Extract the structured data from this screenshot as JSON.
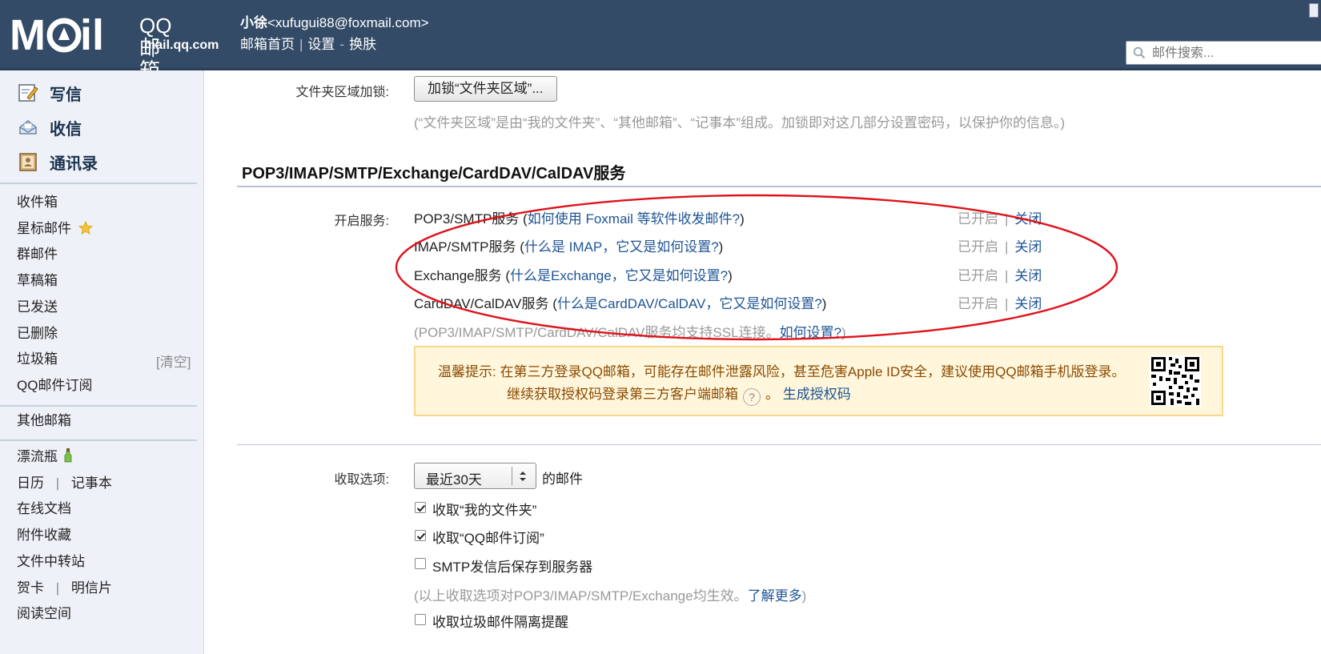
{
  "header": {
    "logo_mail": "M⊙il",
    "logo_qq": "QQ邮箱",
    "logo_domain": "mail.qq.com",
    "user_name": "小徐",
    "user_email": "<xufugui88@foxmail.com>",
    "nav": [
      "邮箱首页",
      "|",
      "设置",
      "-",
      "换肤"
    ],
    "search_placeholder": "邮件搜索..."
  },
  "sidebar": {
    "actions": [
      {
        "label": "写信",
        "icon": "compose-icon"
      },
      {
        "label": "收信",
        "icon": "inbox-tray-icon"
      },
      {
        "label": "通讯录",
        "icon": "contacts-icon"
      }
    ],
    "folders": [
      "收件箱",
      "星标邮件",
      "群邮件",
      "草稿箱",
      "已发送",
      "已删除",
      "垃圾箱",
      "QQ邮件订阅"
    ],
    "spam_clear": "[清空]",
    "other_mail": "其他邮箱",
    "tools": {
      "drift_bottle": "漂流瓶",
      "calendar": "日历",
      "sep": "|",
      "notepad": "记事本",
      "online_docs": "在线文档",
      "attachments": "附件收藏",
      "file_transfer": "文件中转站",
      "greeting_card": "贺卡",
      "postcard": "明信片",
      "reading": "阅读空间"
    }
  },
  "main": {
    "folder_lock": {
      "label": "文件夹区域加锁:",
      "button": "加锁“文件夹区域”...",
      "hint": "(“文件夹区域”是由“我的文件夹”、“其他邮箱”、“记事本”组成。加锁即对这几部分设置密码，以保护你的信息。)"
    },
    "section_title": "POP3/IMAP/SMTP/Exchange/CardDAV/CalDAV服务",
    "services_label": "开启服务:",
    "services": [
      {
        "name": "POP3/SMTP服务",
        "open": "(",
        "link": "如何使用 Foxmail 等软件收发邮件?",
        "close": ")",
        "status": "已开启",
        "sep": "|",
        "action": "关闭"
      },
      {
        "name": "IMAP/SMTP服务",
        "open": "(",
        "link": "什么是 IMAP，它又是如何设置?",
        "close": ")",
        "status": "已开启",
        "sep": "|",
        "action": "关闭"
      },
      {
        "name": "Exchange服务",
        "open": "(",
        "link": "什么是Exchange，它又是如何设置?",
        "close": ")",
        "status": "已开启",
        "sep": "|",
        "action": "关闭"
      },
      {
        "name": "CardDAV/CalDAV服务",
        "open": "(",
        "link": "什么是CardDAV/CalDAV，它又是如何设置?",
        "close": ")",
        "status": "已开启",
        "sep": "|",
        "action": "关闭"
      }
    ],
    "ssl_note": "(POP3/IMAP/SMTP/CardDAV/CalDAV服务均支持SSL连接。",
    "ssl_link": "如何设置?",
    "ssl_close": ")",
    "tip": {
      "prefix": "温馨提示:",
      "line1": "在第三方登录QQ邮箱，可能存在邮件泄露风险，甚至危害Apple ID安全，建议使用QQ邮箱手机版登录。",
      "line2": "继续获取授权码登录第三方客户端邮箱",
      "help": "?",
      "line2_end": "。",
      "link": "生成授权码"
    },
    "fetch": {
      "label": "收取选项:",
      "select_value": "最近30天",
      "suffix": "的邮件",
      "options": [
        {
          "label": "收取“我的文件夹”",
          "checked": true
        },
        {
          "label": "收取“QQ邮件订阅”",
          "checked": true
        },
        {
          "label": "SMTP发信后保存到服务器",
          "checked": false
        }
      ],
      "note": "(以上收取选项对POP3/IMAP/SMTP/Exchange均生效。",
      "note_link": "了解更多",
      "note_close": ")",
      "cut_option": "收取垃圾邮件隔离提醒"
    }
  },
  "colors": {
    "header_bg": "#344b67",
    "sidebar_bg": "#eef2f8",
    "link": "#1e5494",
    "annotation_red": "#e0121b",
    "tip_bg": "#fff6dc"
  }
}
